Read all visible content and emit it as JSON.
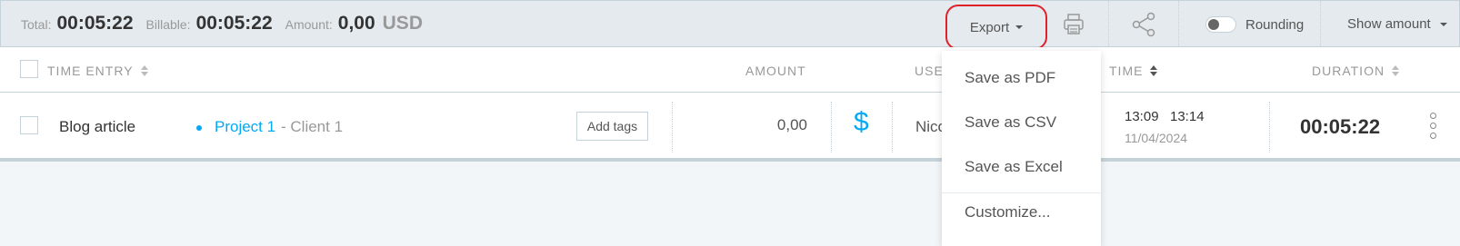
{
  "summary": {
    "total_label": "Total:",
    "total_value": "00:05:22",
    "billable_label": "Billable:",
    "billable_value": "00:05:22",
    "amount_label": "Amount:",
    "amount_value": "0,00",
    "currency": "USD"
  },
  "toolbar": {
    "export_label": "Export",
    "rounding_label": "Rounding",
    "rounding_on": false,
    "show_amount_label": "Show amount",
    "icons": [
      "printer-icon",
      "share-icon"
    ]
  },
  "table": {
    "headers": {
      "time_entry": "TIME ENTRY",
      "amount": "AMOUNT",
      "user": "USE",
      "time": "TIME",
      "duration": "DURATION"
    }
  },
  "entry": {
    "description": "Blog article",
    "project": "Project 1",
    "client": "- Client 1",
    "add_tags_label": "Add tags",
    "amount": "0,00",
    "billable_symbol": "$",
    "user": "Nico",
    "start_time": "13:09",
    "end_time": "13:14",
    "date": "11/04/2024",
    "duration": "00:05:22"
  },
  "export_menu": {
    "items": [
      "Save as PDF",
      "Save as CSV",
      "Save as Excel",
      "Customize..."
    ]
  },
  "colors": {
    "accent": "#03a9f4",
    "highlight_outline": "#e0202b",
    "toolbar_bg": "#e4eaee",
    "page_bg": "#f2f6f8"
  }
}
